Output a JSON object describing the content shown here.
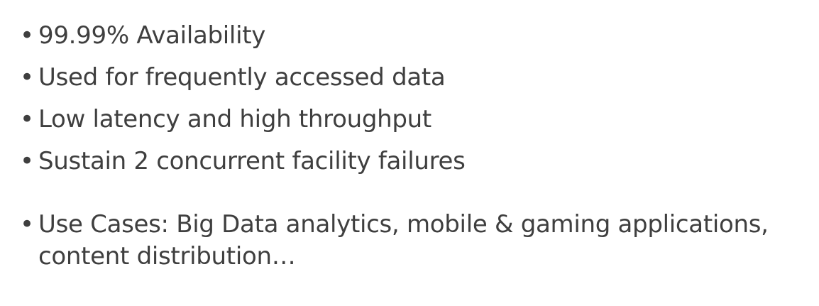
{
  "bullet_symbol": "•",
  "items": [
    "99.99% Availability",
    "Used for frequently accessed data",
    "Low latency and high throughput",
    "Sustain 2 concurrent facility failures",
    "Use Cases: Big Data analytics, mobile & gaming applications, content distribution…"
  ],
  "colors": {
    "text": "#3f3f3f",
    "background": "#ffffff"
  }
}
